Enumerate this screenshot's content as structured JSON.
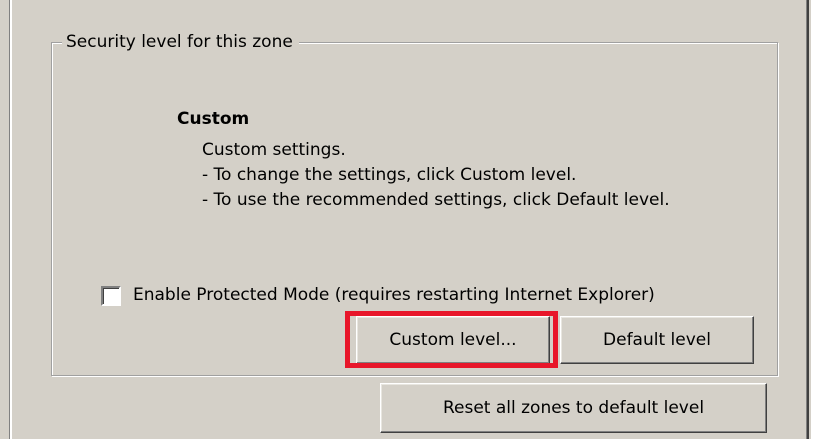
{
  "group": {
    "label": "Security level for this zone"
  },
  "level": {
    "title": "Custom",
    "description": [
      "Custom settings.",
      "- To change the settings, click Custom level.",
      "- To use the recommended settings, click Default level."
    ]
  },
  "protected_mode": {
    "label": "Enable Protected Mode (requires restarting Internet Explorer)",
    "checked": false
  },
  "buttons": {
    "custom_level": "Custom level...",
    "default_level": "Default level",
    "reset_all": "Reset all zones to default level"
  },
  "colors": {
    "background": "#d4d0c8",
    "highlight": "#e8162a"
  }
}
